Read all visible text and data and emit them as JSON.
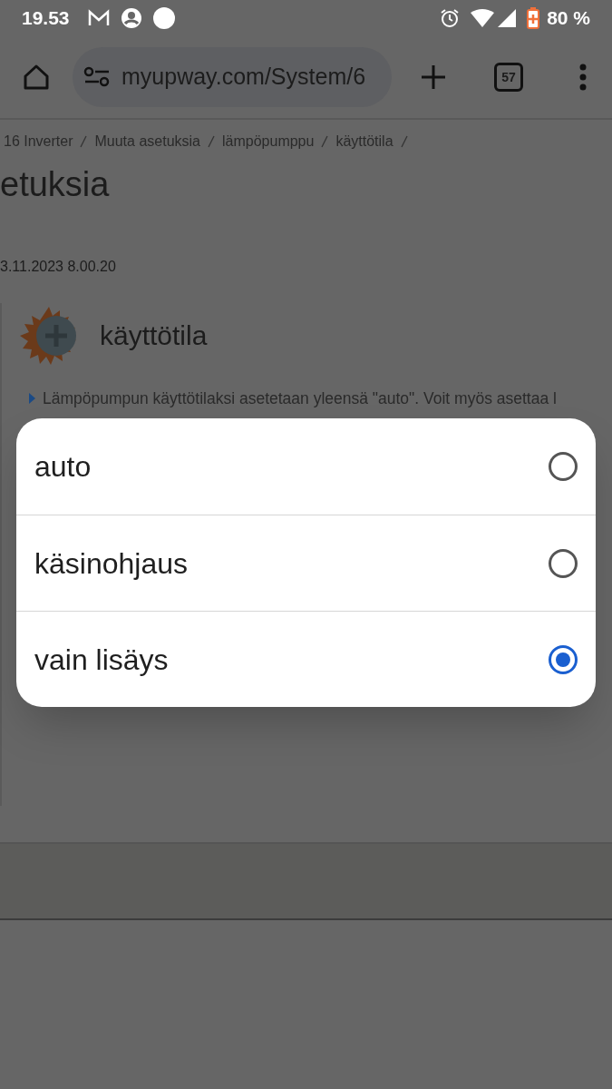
{
  "status_bar": {
    "time": "19.53",
    "battery": "80 %"
  },
  "browser": {
    "url": "myupway.com/System/6",
    "tab_count": "57"
  },
  "breadcrumb": [
    "16 Inverter",
    "Muuta asetuksia",
    "lämpöpumppu",
    "käyttötila"
  ],
  "page_title": "etuksia",
  "timestamp": "3.11.2023 8.00.20",
  "section": {
    "title": "käyttötila",
    "description": "Lämpöpumpun käyttötilaksi asetetaan yleensä \"auto\". Voit myös asettaa l"
  },
  "dialog": {
    "options": [
      {
        "label": "auto",
        "selected": false
      },
      {
        "label": "käsinohjaus",
        "selected": false
      },
      {
        "label": "vain lisäys",
        "selected": true
      }
    ]
  }
}
